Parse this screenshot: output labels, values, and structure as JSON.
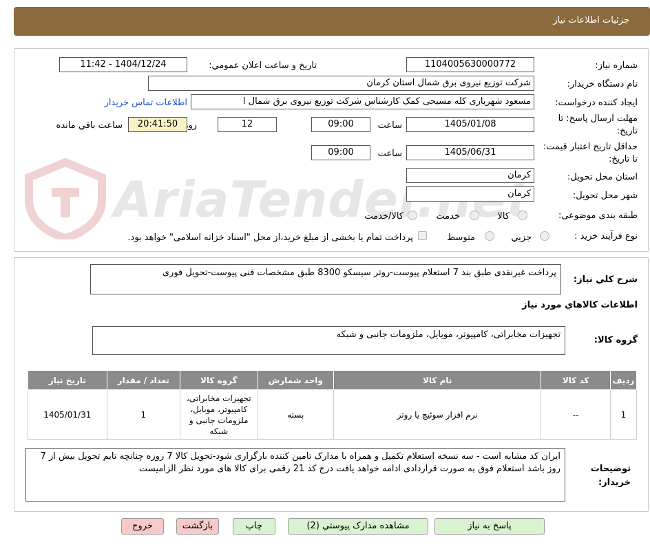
{
  "header": {
    "title": "جزئیات اطلاعات نیاز"
  },
  "watermark": {
    "text": "AriaTender.net"
  },
  "form": {
    "need_number_label": "شماره نیاز:",
    "need_number": "1104005630000772",
    "announce_label": "تاریخ و ساعت اعلان عمومي:",
    "announce_value": "1404/12/24 - 11:42",
    "buyer_org_label": "نام دستگاه خریدار:",
    "buyer_org": "شرکت توزیع نیروی برق شمال استان کرمان",
    "requester_label": "ایجاد کننده درخواست:",
    "requester": "مسعود شهریاری کله مسیحی کمک کارشناس شرکت توزیع نیروی برق شمال ا",
    "contact_link": "اطلاعات تماس خریدار",
    "deadline_label": "مهلت ارسال پاسخ: تا تاریخ:",
    "deadline_date": "1405/01/08",
    "time_label": "ساعت",
    "deadline_time": "09:00",
    "days": "12",
    "days_label": "روز و",
    "remaining": "20:41:50",
    "remaining_label": "ساعت باقي مانده",
    "validity_label": "حداقل تاريخ اعتبار قیمت: تا تاریخ:",
    "validity_date": "1405/06/31",
    "validity_time": "09:00",
    "province_label": "استان محل تحویل:",
    "province": "كرمان",
    "city_label": "شهر محل تحویل:",
    "city": "كرمان",
    "category_label": "طبقه بندی موضوعی:",
    "category_options": [
      "کالا",
      "خدمت",
      "کالا/خدمت"
    ],
    "process_label": "نوع فرآیند خرید :",
    "process_options": [
      "جزیي",
      "متوسط"
    ],
    "payment_note": "پرداخت تمام یا بخشی از مبلغ خرید،از محل \"اسناد خزانه اسلامی\" خواهد بود."
  },
  "summary": {
    "label": "شرح کلي نیاز:",
    "text": "پرداخت غیرنقدی طبق بند 7 استعلام پیوست-روتر سیسکو 8300 طبق مشخصات فنی پیوست-تحویل فوری"
  },
  "goods": {
    "section_title": "اطلاعات کالاهاي مورد نیاز",
    "group_label": "گروه کالا:",
    "group_text": "تجهیزات مخابراتی، کامپیوتر، موبایل، ملزومات جانبی و شبکه",
    "table": {
      "headers": [
        "رديف",
        "کد کالا",
        "نام کالا",
        "واحد شمارش",
        "گروه کالا",
        "تعداد / مقدار",
        "تاریخ نیاز"
      ],
      "rows": [
        [
          "1",
          "--",
          "نرم افزار سوئیچ یا روتر",
          "بسته",
          "تجهیزات مخابراتی، کامپیوتر، موبایل، ملزومات جانبی و شبکه",
          "1",
          "1405/01/31"
        ]
      ]
    }
  },
  "buyer_notes": {
    "label": "توضیحات خریدار:",
    "text": "ایران کد مشابه است - سه نسخه استعلام تکمیل و همراه با مدارک تامین کننده بارگزاری شود-تحویل کالا 7 روزه چنانچه تایم تحویل بیش از 7 روز باشد استعلام فوق به صورت قراردادی ادامه خواهد یافت  درج کد 21 رقمی برای کالا های مورد نظر الزامیست"
  },
  "buttons": {
    "reply": "پاسخ به نیاز",
    "attachments": "مشاهده مدارک پیوستي (2)",
    "print": "چاپ",
    "back": "بازگشت",
    "exit": "خروج"
  }
}
